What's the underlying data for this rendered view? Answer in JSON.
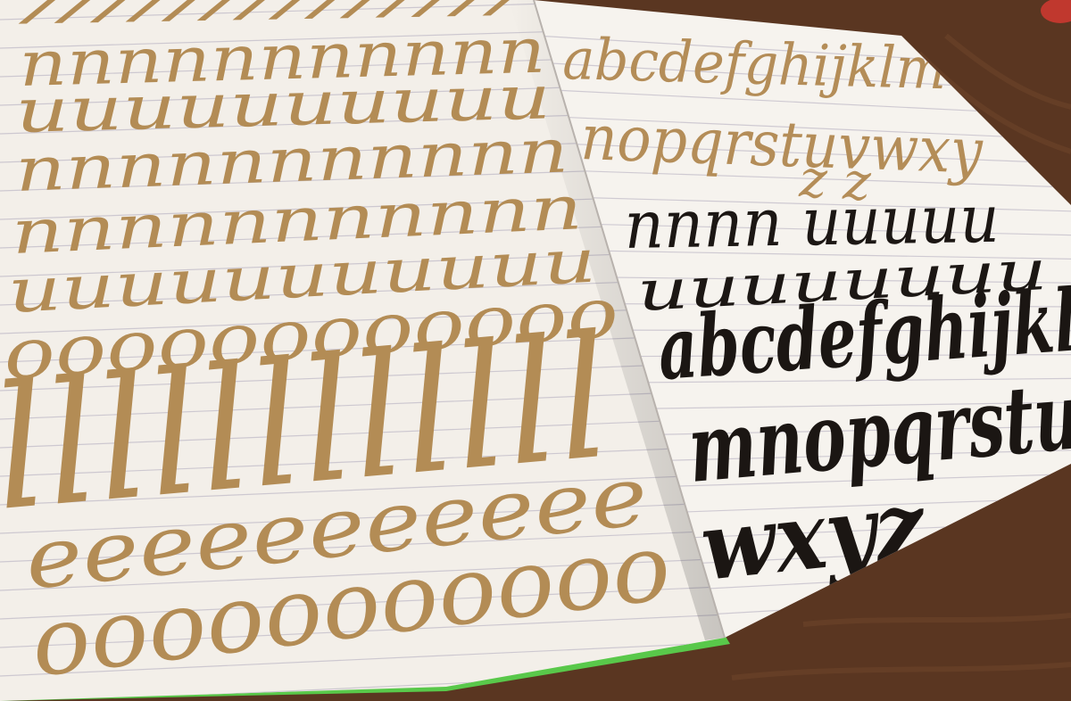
{
  "photo": {
    "subject": "open hand-lettering practice notebook on a wooden table",
    "colors": {
      "table": "#5a3621",
      "paper": "#f3efe9",
      "rule_line": "#cdc8d0",
      "gold_ink": "#b38c55",
      "black_ink": "#1c1714",
      "cover_edge": "#59c84a"
    }
  },
  "left_page": {
    "drill_rows": [
      "//////////////",
      "nnnnnnnnnnn",
      "uuuuuuuuuu",
      "nnnnnnnnnnn",
      "nnnnnnnnnnn",
      "uuuuuuuuuuu",
      "oooooooooooo",
      "llllllllllll",
      "eeeeeeeeeee",
      "ooooooooooo"
    ]
  },
  "right_page": {
    "gold_alphabet": {
      "line1": "abcdefghijklm",
      "line2": "nopqrstuvwxy",
      "line3": "z z"
    },
    "black_drills": {
      "row1": "nnnn uuuuu",
      "row2": "uuuuuuuu"
    },
    "black_alphabet": {
      "line1": "abcdefghijkl",
      "line2": "mnopqrstu",
      "line3": "wxyz"
    }
  }
}
